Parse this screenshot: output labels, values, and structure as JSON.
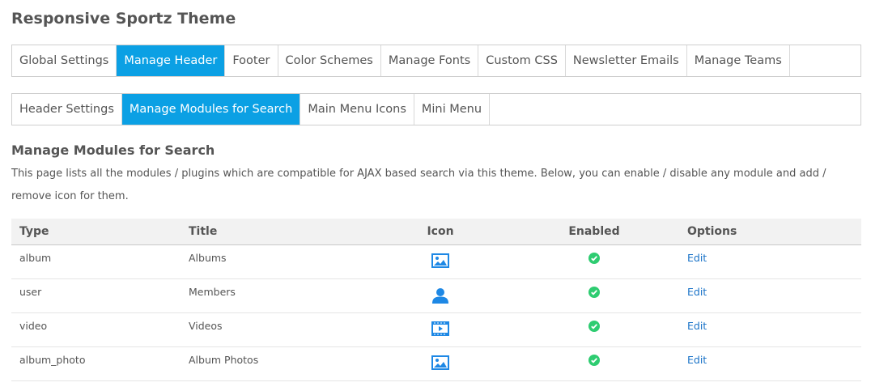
{
  "page": {
    "title": "Responsive Sportz Theme"
  },
  "main_tabs": [
    {
      "label": "Global Settings"
    },
    {
      "label": "Manage Header",
      "active": true
    },
    {
      "label": "Footer"
    },
    {
      "label": "Color Schemes"
    },
    {
      "label": "Manage Fonts"
    },
    {
      "label": "Custom CSS"
    },
    {
      "label": "Newsletter Emails"
    },
    {
      "label": "Manage Teams"
    }
  ],
  "sub_tabs": [
    {
      "label": "Header Settings"
    },
    {
      "label": "Manage Modules for Search",
      "active": true
    },
    {
      "label": "Main Menu Icons"
    },
    {
      "label": "Mini Menu"
    }
  ],
  "section": {
    "heading": "Manage Modules for Search",
    "description": "This page lists all the modules / plugins which are compatible for AJAX based search via this theme. Below, you can enable / disable any module and add / remove icon for them."
  },
  "table": {
    "headers": {
      "type": "Type",
      "title": "Title",
      "icon": "Icon",
      "enabled": "Enabled",
      "options": "Options"
    },
    "rows": [
      {
        "type": "album",
        "title": "Albums",
        "icon": "image-icon",
        "enabled": true,
        "option": "Edit"
      },
      {
        "type": "user",
        "title": "Members",
        "icon": "user-icon",
        "enabled": true,
        "option": "Edit"
      },
      {
        "type": "video",
        "title": "Videos",
        "icon": "video-icon",
        "enabled": true,
        "option": "Edit"
      },
      {
        "type": "album_photo",
        "title": "Album Photos",
        "icon": "image-icon",
        "enabled": true,
        "option": "Edit"
      }
    ]
  },
  "colors": {
    "accent": "#0ba0e4",
    "icon_blue": "#1e88e5",
    "enabled_green": "#2ecc71",
    "link": "#1a73c8"
  }
}
